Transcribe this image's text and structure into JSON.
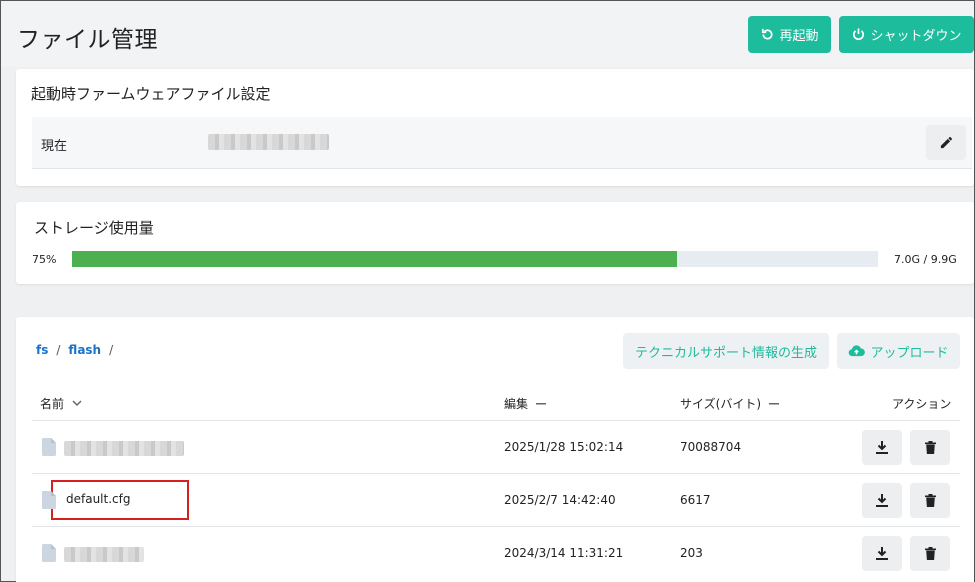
{
  "page": {
    "title": "ファイル管理"
  },
  "header": {
    "restart_label": "再起動",
    "shutdown_label": "シャットダウン",
    "accent_color": "#1cbc9c"
  },
  "firmware": {
    "title": "起動時ファームウェアファイル設定",
    "current_label": "現在",
    "current_value": ""
  },
  "storage": {
    "title": "ストレージ使用量",
    "percent_label": "75%",
    "usage_label": "7.0G / 9.9G",
    "percent": 75,
    "bar_color": "#4caf50"
  },
  "files": {
    "breadcrumb": [
      "fs",
      "flash"
    ],
    "tech_support_label": "テクニカルサポート情報の生成",
    "upload_label": "アップロード",
    "columns": {
      "name": "名前",
      "modified": "編集",
      "size": "サイズ(バイト)",
      "actions": "アクション"
    },
    "rows": [
      {
        "name": "",
        "modified": "2025/1/28 15:02:14",
        "size": "70088704"
      },
      {
        "name": "default.cfg",
        "modified": "2025/2/7 14:42:40",
        "size": "6617"
      },
      {
        "name": "",
        "modified": "2024/3/14 11:31:21",
        "size": "203"
      }
    ]
  }
}
